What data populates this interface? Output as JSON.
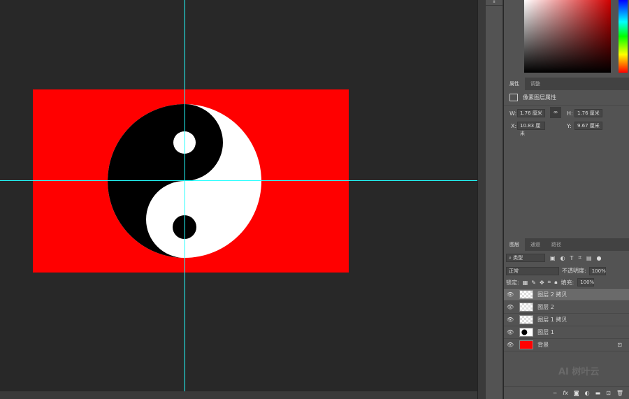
{
  "properties": {
    "tabs": [
      "属性",
      "调整"
    ],
    "title": "像素图层属性",
    "w_label": "W:",
    "w": "1.76 厘米",
    "h_label": "H:",
    "h": "1.76 厘米",
    "x_label": "X:",
    "x": "10.83 厘米",
    "y_label": "Y:",
    "y": "9.67 厘米"
  },
  "layers_panel": {
    "tabs": [
      "图层",
      "通道",
      "路径"
    ],
    "filter": "类型",
    "blend_mode": "正常",
    "opacity_label": "不透明度:",
    "opacity": "100%",
    "lock_label": "锁定:",
    "fill_label": "填充:",
    "fill": "100%",
    "layers": [
      {
        "name": "图层 2 拷贝"
      },
      {
        "name": "图层 2"
      },
      {
        "name": "图层 1 拷贝"
      },
      {
        "name": "图层 1"
      },
      {
        "name": "背景"
      }
    ]
  },
  "watermark": "AI 树叶云",
  "colors": {
    "canvas_bg": "#ff0000",
    "guide": "#22ffff"
  }
}
